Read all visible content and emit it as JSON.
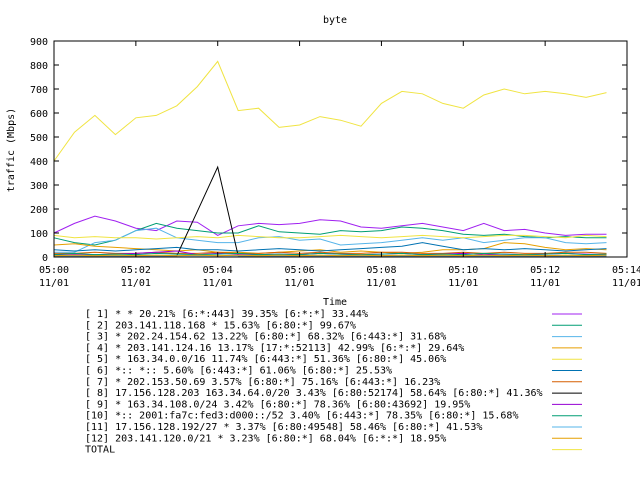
{
  "chart_data": {
    "type": "line",
    "title": "byte",
    "xlabel": "Time",
    "ylabel": "traffic (Mbps)",
    "ylim": [
      0,
      900
    ],
    "y_ticks": [
      0,
      100,
      200,
      300,
      400,
      500,
      600,
      700,
      800,
      900
    ],
    "xlim": [
      0,
      9
    ],
    "x_ticks": [
      {
        "x": 0,
        "time": "05:00",
        "date": "11/01"
      },
      {
        "x": 2,
        "time": "05:02",
        "date": "11/01"
      },
      {
        "x": 4,
        "time": "05:04",
        "date": "11/01"
      },
      {
        "x": 6,
        "time": "05:06",
        "date": "11/01"
      },
      {
        "x": 8,
        "time": "05:08",
        "date": "11/01"
      },
      {
        "x": 10,
        "time": "05:10",
        "date": "11/01"
      },
      {
        "x": 12,
        "time": "05:12",
        "date": "11/01"
      },
      {
        "x": 14,
        "time": "05:14",
        "date": "11/01"
      }
    ],
    "x_minutes": [
      0,
      0.5,
      1,
      1.5,
      2,
      2.5,
      3,
      3.5,
      4,
      4.5,
      5,
      5.5,
      6,
      6.5,
      7,
      7.5,
      8,
      8.5,
      9,
      9.5,
      10,
      10.5,
      11,
      11.5,
      12,
      12.5,
      13,
      13.5
    ],
    "series": [
      {
        "name": "[ 1] * * 20.21%  [6:*:443] 39.35% [6:*:*] 33.44%",
        "color": "#a020f0",
        "values": [
          100,
          140,
          170,
          150,
          120,
          110,
          150,
          145,
          90,
          130,
          140,
          135,
          140,
          155,
          150,
          125,
          120,
          130,
          140,
          125,
          110,
          140,
          110,
          115,
          100,
          90,
          95,
          95
        ]
      },
      {
        "name": "[ 2] 203.141.118.168 * 15.63%  [6:80:*] 99.67%",
        "color": "#009e73",
        "values": [
          80,
          60,
          50,
          70,
          110,
          140,
          120,
          110,
          100,
          100,
          130,
          105,
          100,
          95,
          110,
          105,
          110,
          125,
          120,
          110,
          95,
          90,
          95,
          85,
          80,
          85,
          80,
          80
        ]
      },
      {
        "name": "[ 3] * 202.24.154.62 13.22%  [6:80:*] 68.32% [6:443:*] 31.68%",
        "color": "#56b4e9",
        "values": [
          20,
          20,
          60,
          70,
          110,
          120,
          80,
          70,
          60,
          60,
          80,
          85,
          70,
          75,
          50,
          55,
          60,
          70,
          80,
          70,
          80,
          60,
          70,
          80,
          80,
          60,
          55,
          60
        ]
      },
      {
        "name": "[ 4] * 203.141.124.16 13.17%  [17:*:52113] 42.99% [6:*:*] 29.64%",
        "color": "#e69f00",
        "values": [
          50,
          55,
          45,
          40,
          35,
          30,
          25,
          30,
          20,
          20,
          15,
          20,
          25,
          30,
          20,
          25,
          20,
          15,
          20,
          30,
          30,
          35,
          60,
          55,
          40,
          30,
          35,
          30
        ]
      },
      {
        "name": "[ 5] * 163.34.0.0/16 11.74%  [6:443:*] 51.36% [6:80:*] 45.06%",
        "color": "#f0e442",
        "values": [
          90,
          80,
          85,
          80,
          80,
          75,
          80,
          85,
          80,
          90,
          85,
          80,
          80,
          85,
          90,
          85,
          80,
          85,
          90,
          85,
          80,
          85,
          90,
          90,
          85,
          80,
          90,
          85
        ]
      },
      {
        "name": "[ 6] *:: *:: 5.60%  [6:443:*] 61.06% [6:80:*] 25.53%",
        "color": "#0072b2",
        "values": [
          30,
          25,
          30,
          25,
          30,
          35,
          40,
          30,
          30,
          25,
          30,
          35,
          30,
          25,
          30,
          35,
          40,
          45,
          60,
          45,
          30,
          35,
          30,
          35,
          30,
          25,
          30,
          35
        ]
      },
      {
        "name": "[ 7] * 202.153.50.69 3.57%  [6:80:*] 75.16% [6:443:*] 16.23%",
        "color": "#d55e00",
        "values": [
          15,
          15,
          20,
          15,
          15,
          20,
          15,
          15,
          20,
          15,
          15,
          20,
          15,
          20,
          15,
          15,
          20,
          20,
          15,
          15,
          20,
          15,
          20,
          15,
          15,
          20,
          20,
          15
        ]
      },
      {
        "name": "[ 8] 17.156.128.203 163.34.64.0/20 3.43%  [6:80:52174] 58.64% [6:80:*] 41.36%",
        "color": "#000000",
        "values": [
          5,
          5,
          5,
          5,
          5,
          5,
          5,
          190,
          375,
          5,
          5,
          5,
          5,
          5,
          5,
          5,
          5,
          5,
          5,
          5,
          5,
          5,
          5,
          5,
          5,
          5,
          5,
          5
        ]
      },
      {
        "name": "[ 9] * 163.34.108.0/24 3.42%  [6:80:*] 78.36% [6:80:43692] 19.95%",
        "color": "#9400d3",
        "values": [
          10,
          12,
          10,
          12,
          15,
          20,
          25,
          10,
          15,
          12,
          10,
          12,
          10,
          15,
          12,
          10,
          12,
          15,
          10,
          12,
          15,
          10,
          12,
          10,
          12,
          15,
          12,
          10
        ]
      },
      {
        "name": "[10] *:: 2001:fa7c:fed3:d000::/52 3.40%  [6:443:*] 78.35% [6:80:*] 15.68%",
        "color": "#009e73",
        "values": [
          10,
          15,
          10,
          12,
          10,
          15,
          12,
          10,
          12,
          15,
          10,
          12,
          10,
          15,
          12,
          10,
          12,
          15,
          10,
          12,
          10,
          15,
          12,
          10,
          12,
          15,
          10,
          12
        ]
      },
      {
        "name": "[11] 17.156.128.192/27 * 3.37%  [6:80:49548] 58.46% [6:80:*] 41.53%",
        "color": "#56b4e9",
        "values": [
          5,
          5,
          5,
          5,
          5,
          5,
          5,
          5,
          5,
          5,
          5,
          5,
          5,
          5,
          5,
          5,
          5,
          5,
          5,
          5,
          5,
          5,
          5,
          5,
          5,
          5,
          5,
          5
        ]
      },
      {
        "name": "[12] 203.141.120.0/21 * 3.23%  [6:80:*] 68.04% [6:*:*] 18.95%",
        "color": "#e69f00",
        "values": [
          5,
          8,
          5,
          8,
          5,
          8,
          5,
          8,
          5,
          8,
          5,
          8,
          5,
          8,
          5,
          8,
          5,
          8,
          5,
          8,
          5,
          8,
          5,
          8,
          5,
          8,
          5,
          8
        ]
      },
      {
        "name": "TOTAL",
        "color": "#f0e442",
        "values": [
          400,
          520,
          590,
          510,
          580,
          590,
          630,
          710,
          815,
          610,
          620,
          540,
          550,
          585,
          570,
          545,
          640,
          690,
          680,
          640,
          620,
          675,
          700,
          680,
          690,
          680,
          665,
          685
        ]
      }
    ]
  }
}
